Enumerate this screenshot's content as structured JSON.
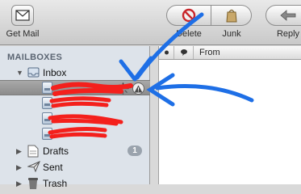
{
  "toolbar": {
    "get_mail": "Get Mail",
    "delete": "Delete",
    "junk": "Junk",
    "reply": "Reply"
  },
  "sidebar": {
    "header": "MAILBOXES",
    "inbox": "Inbox",
    "drafts": "Drafts",
    "drafts_count": "1",
    "sent": "Sent",
    "trash": "Trash"
  },
  "message_list": {
    "columns": [
      "",
      "",
      "From"
    ]
  },
  "icons": {
    "get_mail": "envelope-icon",
    "delete": "no-entry-icon",
    "junk": "junk-bag-icon",
    "reply": "reply-arrow-icon",
    "inbox": "inbox-tray-icon",
    "account": "mailbox-icon",
    "drafts": "drafts-document-icon",
    "sent": "sent-plane-icon",
    "trash": "trash-can-icon",
    "activity": "activity-spinner-icon",
    "warning": "warning-icon"
  },
  "colors": {
    "annotation_blue": "#1e6fe6",
    "redaction_red": "#f4201c",
    "selection_gray": "#999999",
    "sidebar_bg": "#dde3ea"
  }
}
